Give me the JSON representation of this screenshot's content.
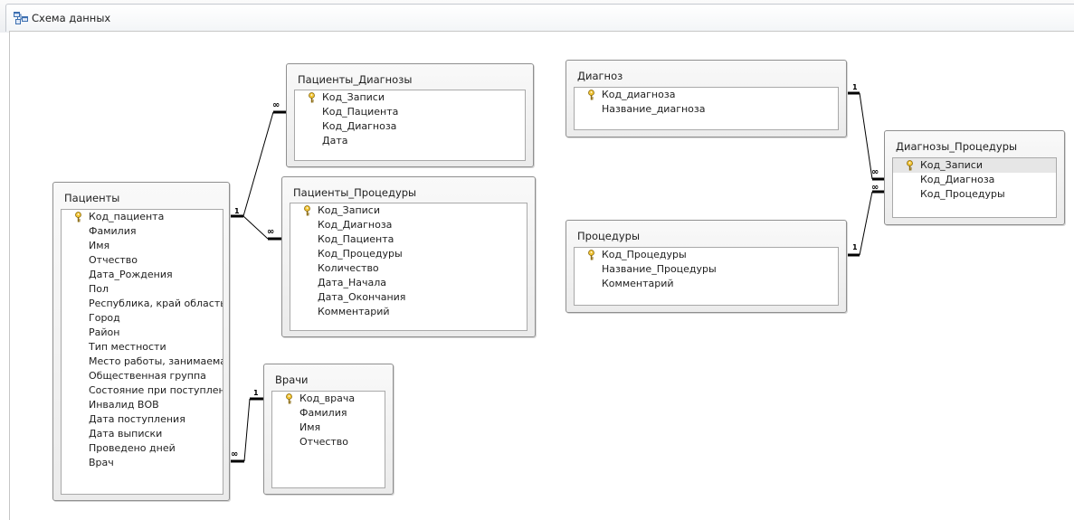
{
  "window": {
    "title": "Схема данных",
    "icon": "relationships-icon"
  },
  "tables": [
    {
      "id": "patients",
      "title": "Пациенты",
      "fields": [
        {
          "label": "Код_пациента",
          "key": true
        },
        {
          "label": "Фамилия"
        },
        {
          "label": "Имя"
        },
        {
          "label": "Отчество"
        },
        {
          "label": "Дата_Рождения"
        },
        {
          "label": "Пол"
        },
        {
          "label": "Республика, край область"
        },
        {
          "label": "Город"
        },
        {
          "label": "Район"
        },
        {
          "label": "Тип местности"
        },
        {
          "label": "Место работы, занимаемая"
        },
        {
          "label": "Общественная группа"
        },
        {
          "label": "Состояние при поступлении"
        },
        {
          "label": "Инвалид ВОВ"
        },
        {
          "label": "Дата поступления"
        },
        {
          "label": "Дата выписки"
        },
        {
          "label": "Проведено дней"
        },
        {
          "label": "Врач"
        }
      ]
    },
    {
      "id": "patients-diagnoses",
      "title": "Пациенты_Диагнозы",
      "fields": [
        {
          "label": "Код_Записи",
          "key": true
        },
        {
          "label": "Код_Пациента"
        },
        {
          "label": "Код_Диагноза"
        },
        {
          "label": "Дата"
        }
      ]
    },
    {
      "id": "patients-procedures",
      "title": "Пациенты_Процедуры",
      "fields": [
        {
          "label": "Код_Записи",
          "key": true
        },
        {
          "label": "Код_Диагноза"
        },
        {
          "label": "Код_Пациента"
        },
        {
          "label": "Код_Процедуры"
        },
        {
          "label": "Количество"
        },
        {
          "label": "Дата_Начала"
        },
        {
          "label": "Дата_Окончания"
        },
        {
          "label": "Комментарий"
        }
      ]
    },
    {
      "id": "doctors",
      "title": "Врачи",
      "fields": [
        {
          "label": "Код_врача",
          "key": true
        },
        {
          "label": "Фамилия"
        },
        {
          "label": "Имя"
        },
        {
          "label": "Отчество"
        }
      ]
    },
    {
      "id": "diagnosis",
      "title": "Диагноз",
      "fields": [
        {
          "label": "Код_диагноза",
          "key": true
        },
        {
          "label": "Название_диагноза"
        }
      ]
    },
    {
      "id": "procedures",
      "title": "Процедуры",
      "fields": [
        {
          "label": "Код_Процедуры",
          "key": true
        },
        {
          "label": "Название_Процедуры"
        },
        {
          "label": "Комментарий"
        }
      ]
    },
    {
      "id": "diagnoses-procedures",
      "title": "Диагнозы_Процедуры",
      "fields": [
        {
          "label": "Код_Записи",
          "key": true,
          "selected": true
        },
        {
          "label": "Код_Диагноза"
        },
        {
          "label": "Код_Процедуры"
        }
      ]
    }
  ],
  "relationships": [
    {
      "from": "patients",
      "to": "patients-diagnoses",
      "one": "1",
      "many": "∞"
    },
    {
      "from": "patients",
      "to": "patients-procedures",
      "one": "1",
      "many": "∞"
    },
    {
      "from": "doctors",
      "to": "patients",
      "one": "1",
      "many": "∞"
    },
    {
      "from": "diagnosis",
      "to": "diagnoses-procedures",
      "one": "1",
      "many": "∞"
    },
    {
      "from": "procedures",
      "to": "diagnoses-procedures",
      "one": "1",
      "many": "∞"
    }
  ]
}
